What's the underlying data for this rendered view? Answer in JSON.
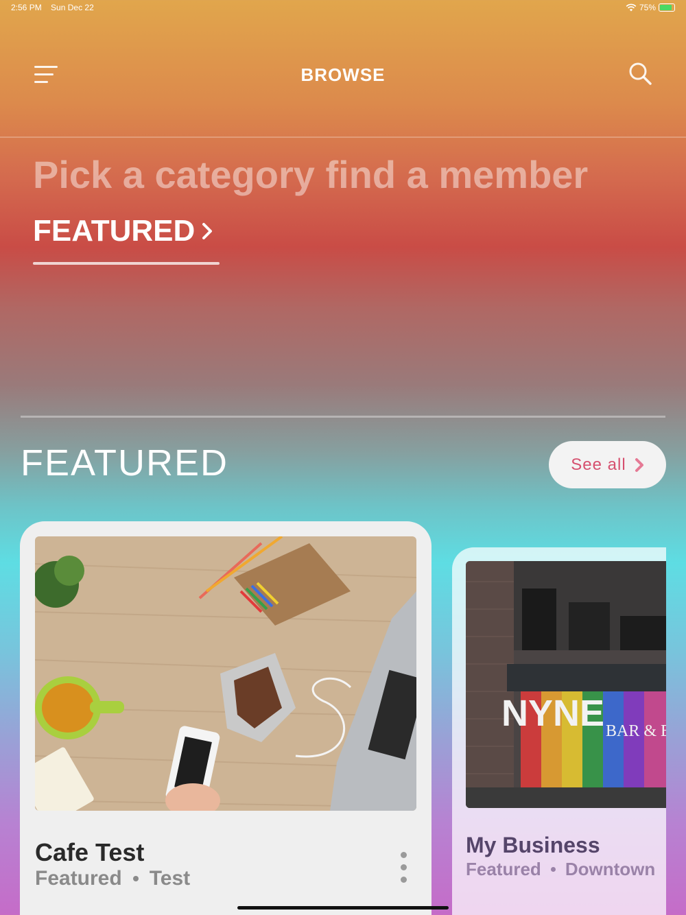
{
  "status_bar": {
    "time": "2:56 PM",
    "date": "Sun Dec 22",
    "battery": "75%",
    "battery_level": 0.75
  },
  "header": {
    "title": "BROWSE",
    "menu_icon": "hamburger-menu-icon",
    "search_icon": "search-icon"
  },
  "hero": {
    "tagline": "Pick a category find a member",
    "category_tab": "FEATURED"
  },
  "featured_section": {
    "title": "FEATURED",
    "see_all_label": "See all",
    "cards": [
      {
        "name": "Cafe Test",
        "tags": [
          "Featured",
          "Test"
        ],
        "image": "desk-workspace-photo"
      },
      {
        "name": "My Business",
        "tags": [
          "Featured",
          "Downtown"
        ],
        "image": "nyne-bar-bistro-storefront-photo",
        "sign_text": "NYNE",
        "sign_subtext": "BAR & BIST"
      }
    ]
  },
  "colors": {
    "accent": "#d6506f",
    "card_bg": "#efefef",
    "text_dark": "#2a2a2a",
    "text_muted": "#8a8a8a"
  }
}
